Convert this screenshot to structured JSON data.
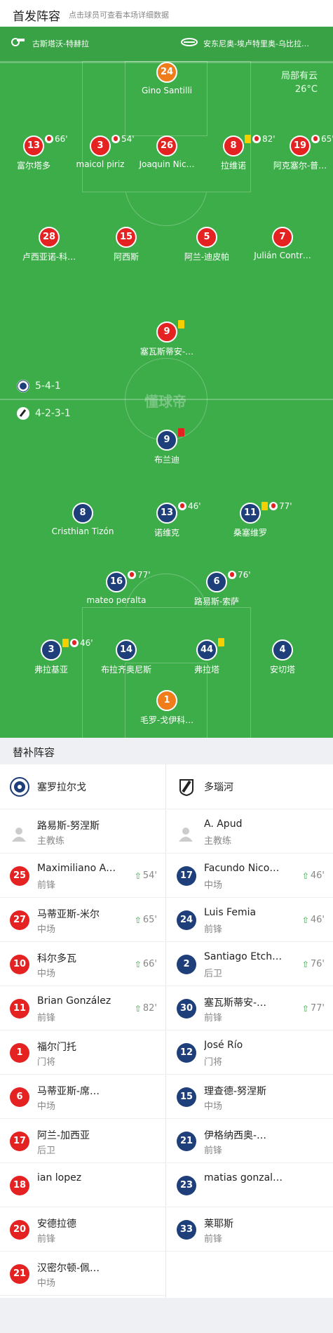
{
  "header": {
    "title": "首发阵容",
    "subtitle": "点击球员可查看本场详细数据"
  },
  "teams": {
    "home_coach_label": "古斯塔沃-特赫拉",
    "away_coach_label": "安东尼奥-埃卢特里奥-乌比拉…"
  },
  "weather": {
    "desc": "局部有云",
    "temp": "26°C"
  },
  "formations": {
    "home": "5-4-1",
    "away": "4-2-3-1"
  },
  "watermark": "懂球帝",
  "colors": {
    "pitch": "#3dad4a",
    "home": "#e52222",
    "away": "#1e3f7a",
    "keeper": "#f07d1b"
  },
  "players": [
    {
      "num": "24",
      "name": "Gino Santilli",
      "color": "orange",
      "events": []
    },
    {
      "num": "13",
      "name": "富尔塔多",
      "color": "red",
      "events": [
        {
          "t": "sub"
        },
        {
          "t": "min",
          "v": "66'"
        }
      ]
    },
    {
      "num": "3",
      "name": "maicol piriz",
      "color": "red",
      "events": [
        {
          "t": "sub"
        },
        {
          "t": "min",
          "v": "54'"
        }
      ]
    },
    {
      "num": "26",
      "name": "Joaquin Nic…",
      "color": "red",
      "events": []
    },
    {
      "num": "8",
      "name": "拉维诺",
      "color": "red",
      "events": [
        {
          "t": "y"
        },
        {
          "t": "sub"
        },
        {
          "t": "min",
          "v": "82'"
        }
      ]
    },
    {
      "num": "19",
      "name": "阿克塞尔-普…",
      "color": "red",
      "events": [
        {
          "t": "sub"
        },
        {
          "t": "min",
          "v": "65'"
        }
      ]
    },
    {
      "num": "28",
      "name": "卢西亚诺-科…",
      "color": "red",
      "events": []
    },
    {
      "num": "15",
      "name": "阿西斯",
      "color": "red",
      "events": []
    },
    {
      "num": "5",
      "name": "阿兰-迪皮帕",
      "color": "red",
      "events": []
    },
    {
      "num": "7",
      "name": "Julián Contr…",
      "color": "red",
      "events": []
    },
    {
      "num": "9",
      "name": "塞瓦斯蒂安-…",
      "color": "red",
      "events": [
        {
          "t": "y"
        }
      ]
    },
    {
      "num": "9",
      "name": "布兰迪",
      "color": "blue",
      "events": [
        {
          "t": "r"
        }
      ]
    },
    {
      "num": "8",
      "name": "Cristhian Tizón",
      "color": "blue",
      "events": []
    },
    {
      "num": "13",
      "name": "诺维克",
      "color": "blue",
      "events": [
        {
          "t": "sub"
        },
        {
          "t": "min",
          "v": "46'"
        }
      ]
    },
    {
      "num": "11",
      "name": "桑塞维罗",
      "color": "blue",
      "events": [
        {
          "t": "y"
        },
        {
          "t": "sub"
        },
        {
          "t": "min",
          "v": "77'"
        }
      ]
    },
    {
      "num": "16",
      "name": "mateo peralta",
      "color": "blue",
      "events": [
        {
          "t": "sub"
        },
        {
          "t": "min",
          "v": "77'"
        }
      ]
    },
    {
      "num": "6",
      "name": "路易斯-索萨",
      "color": "blue",
      "events": [
        {
          "t": "sub"
        },
        {
          "t": "min",
          "v": "76'"
        }
      ]
    },
    {
      "num": "3",
      "name": "弗拉基亚",
      "color": "blue",
      "events": [
        {
          "t": "y"
        },
        {
          "t": "sub"
        },
        {
          "t": "min",
          "v": "46'"
        }
      ]
    },
    {
      "num": "14",
      "name": "布拉齐奥尼斯",
      "color": "blue",
      "events": []
    },
    {
      "num": "44",
      "name": "弗拉塔",
      "color": "blue",
      "events": [
        {
          "t": "y"
        }
      ]
    },
    {
      "num": "4",
      "name": "安切塔",
      "color": "blue",
      "events": []
    },
    {
      "num": "1",
      "name": "毛罗-戈伊科…",
      "color": "orange",
      "events": []
    }
  ],
  "subs": {
    "title": "替补阵容",
    "home_team": "塞罗拉尔戈",
    "away_team": "多瑙河",
    "home": [
      {
        "type": "coach",
        "name": "路易斯-努涅斯",
        "pos": "主教练"
      },
      {
        "num": "25",
        "name": "Maximiliano A…",
        "pos": "前锋",
        "in": "54'"
      },
      {
        "num": "27",
        "name": "马蒂亚斯-米尔",
        "pos": "中场",
        "in": "65'"
      },
      {
        "num": "10",
        "name": "科尔多瓦",
        "pos": "中场",
        "in": "66'"
      },
      {
        "num": "11",
        "name": "Brian González",
        "pos": "前锋",
        "in": "82'"
      },
      {
        "num": "1",
        "name": "福尔门托",
        "pos": "门将",
        "in": ""
      },
      {
        "num": "6",
        "name": "马蒂亚斯-席…",
        "pos": "中场",
        "in": ""
      },
      {
        "num": "17",
        "name": "阿兰-加西亚",
        "pos": "后卫",
        "in": ""
      },
      {
        "num": "18",
        "name": "ian lopez",
        "pos": "",
        "in": ""
      },
      {
        "num": "20",
        "name": "安德拉德",
        "pos": "前锋",
        "in": ""
      },
      {
        "num": "21",
        "name": "汉密尔顿-佩…",
        "pos": "中场",
        "in": ""
      }
    ],
    "away": [
      {
        "type": "coach",
        "name": "A. Apud",
        "pos": "主教练"
      },
      {
        "num": "17",
        "name": "Facundo Nico…",
        "pos": "中场",
        "in": "46'"
      },
      {
        "num": "24",
        "name": "Luis Femia",
        "pos": "前锋",
        "in": "46'"
      },
      {
        "num": "2",
        "name": "Santiago Etch…",
        "pos": "后卫",
        "in": "76'"
      },
      {
        "num": "30",
        "name": "塞瓦斯蒂安-…",
        "pos": "前锋",
        "in": "77'"
      },
      {
        "num": "12",
        "name": "José Río",
        "pos": "门将",
        "in": ""
      },
      {
        "num": "15",
        "name": "理查德-努涅斯",
        "pos": "中场",
        "in": ""
      },
      {
        "num": "21",
        "name": "伊格纳西奥-…",
        "pos": "前锋",
        "in": ""
      },
      {
        "num": "23",
        "name": "matias gonzal…",
        "pos": "",
        "in": ""
      },
      {
        "num": "33",
        "name": "莱耶斯",
        "pos": "前锋",
        "in": ""
      }
    ]
  }
}
